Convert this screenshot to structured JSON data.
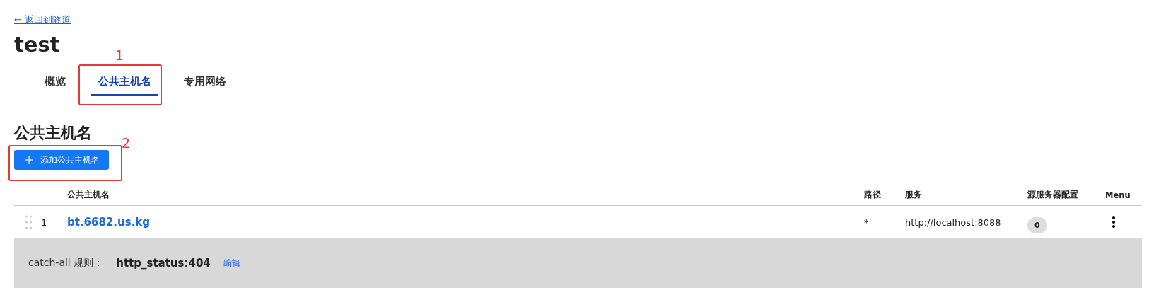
{
  "back_link": "← 返回到隧道",
  "title": "test",
  "tabs": [
    {
      "label": "概览",
      "selected": false
    },
    {
      "label": "公共主机名",
      "selected": true
    },
    {
      "label": "专用网络",
      "selected": false
    }
  ],
  "section": {
    "heading": "公共主机名",
    "add_button": "添加公共主机名"
  },
  "table": {
    "columns": [
      "公共主机名",
      "路径",
      "服务",
      "源服务器配置",
      "Menu"
    ],
    "rows": [
      {
        "index": "1",
        "hostname": "bt.6682.us.kg",
        "path": "*",
        "service": "http://localhost:8088",
        "origin_config_count": "0"
      }
    ]
  },
  "catch_all": {
    "label": "catch-all 规则：",
    "value": "http_status:404",
    "edit": "编辑"
  },
  "annotations": [
    {
      "label": "1"
    },
    {
      "label": "2"
    }
  ]
}
